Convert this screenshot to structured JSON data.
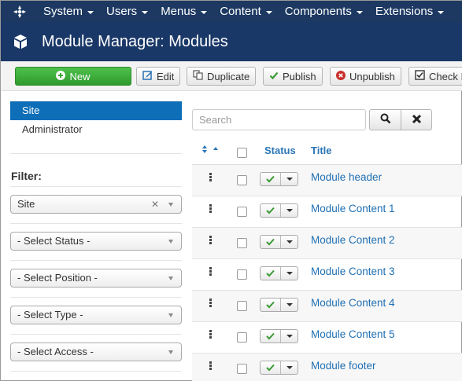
{
  "topnav": {
    "items": [
      {
        "label": "System"
      },
      {
        "label": "Users"
      },
      {
        "label": "Menus"
      },
      {
        "label": "Content"
      },
      {
        "label": "Components"
      },
      {
        "label": "Extensions"
      }
    ]
  },
  "header": {
    "title": "Module Manager: Modules"
  },
  "toolbar": {
    "new_label": "New",
    "edit_label": "Edit",
    "duplicate_label": "Duplicate",
    "publish_label": "Publish",
    "unpublish_label": "Unpublish",
    "checkin_label": "Check In"
  },
  "sidebar": {
    "items": [
      {
        "label": "Site",
        "active": true
      },
      {
        "label": "Administrator",
        "active": false
      }
    ],
    "filter_label": "Filter:",
    "filters": {
      "client_value": "Site",
      "status_value": "- Select Status -",
      "position_value": "- Select Position -",
      "type_value": "- Select Type -",
      "access_value": "- Select Access -"
    }
  },
  "search": {
    "placeholder": "Search"
  },
  "table": {
    "columns": {
      "status": "Status",
      "title": "Title"
    },
    "rows": [
      {
        "title": "Module header",
        "published": true
      },
      {
        "title": "Module Content 1",
        "published": true
      },
      {
        "title": "Module Content 2",
        "published": true
      },
      {
        "title": "Module Content 3",
        "published": true
      },
      {
        "title": "Module Content 4",
        "published": true
      },
      {
        "title": "Module Content 5",
        "published": true
      },
      {
        "title": "Module footer",
        "published": true
      }
    ]
  },
  "colors": {
    "nav_bg": "#1d3962",
    "header_bg": "#1a3867",
    "accent": "#0f6eb8",
    "new_button": "#3aab38",
    "link": "#1f6fb3",
    "publish_green": "#3a9a35",
    "unpublish_red": "#c9302c"
  },
  "icons": {
    "logo": "joomla-logo",
    "header": "cube-icon",
    "new": "plus-circle-icon",
    "edit": "edit-icon",
    "duplicate": "copy-icon",
    "publish": "check-icon",
    "unpublish": "times-circle-icon",
    "checkin": "checkbox-icon",
    "search": "search-icon",
    "clear": "close-icon",
    "sort": "sort-icon",
    "drag": "drag-handle-icon"
  }
}
